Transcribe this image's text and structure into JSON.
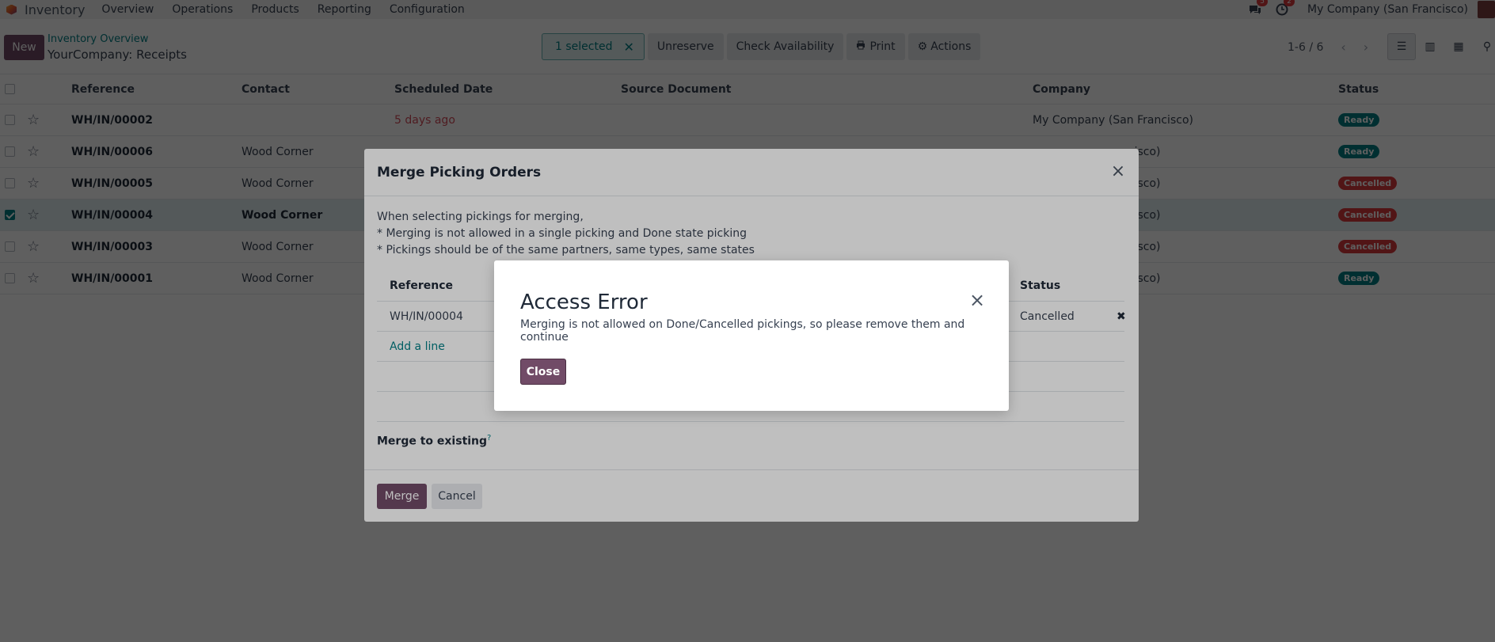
{
  "navbar": {
    "app_name": "Inventory",
    "menu": [
      "Overview",
      "Operations",
      "Products",
      "Reporting",
      "Configuration"
    ],
    "messages_count": "5",
    "activities_count": "2",
    "company": "My Company (San Francisco)"
  },
  "control_panel": {
    "new_label": "New",
    "breadcrumb_parent": "Inventory Overview",
    "breadcrumb_current": "YourCompany: Receipts",
    "selected_label": "1 selected",
    "unreserve_label": "Unreserve",
    "check_availability_label": "Check Availability",
    "print_label": "Print",
    "actions_label": "Actions",
    "pager": "1-6 / 6"
  },
  "list": {
    "headers": {
      "reference": "Reference",
      "contact": "Contact",
      "scheduled_date": "Scheduled Date",
      "source_document": "Source Document",
      "company": "Company",
      "status": "Status"
    },
    "rows": [
      {
        "reference": "WH/IN/00002",
        "contact": "",
        "date": "5 days ago",
        "company": "My Company (San Francisco)",
        "status": "Ready",
        "checked": false
      },
      {
        "reference": "WH/IN/00006",
        "contact": "Wood Corner",
        "date": "",
        "company": "ncisco)",
        "status": "Ready",
        "checked": false
      },
      {
        "reference": "WH/IN/00005",
        "contact": "Wood Corner",
        "date": "",
        "company": "ncisco)",
        "status": "Cancelled",
        "checked": false
      },
      {
        "reference": "WH/IN/00004",
        "contact": "Wood Corner",
        "date": "",
        "company": "ncisco)",
        "status": "Cancelled",
        "checked": true
      },
      {
        "reference": "WH/IN/00003",
        "contact": "Wood Corner",
        "date": "",
        "company": "ncisco)",
        "status": "Cancelled",
        "checked": false
      },
      {
        "reference": "WH/IN/00001",
        "contact": "Wood Corner",
        "date": "",
        "company": "ncisco)",
        "status": "Ready",
        "checked": false
      }
    ]
  },
  "merge_dialog": {
    "title": "Merge Picking Orders",
    "line1": "When selecting pickings for merging,",
    "line2": "* Merging is not allowed in a single picking and Done state picking",
    "line3": "* Pickings should be of the same partners, same types, same states",
    "col_reference": "Reference",
    "col_status": "Status",
    "row_reference": "WH/IN/00004",
    "row_status": "Cancelled",
    "add_line": "Add a line",
    "merge_existing": "Merge to existing",
    "merge_help": "?",
    "merge_label": "Merge",
    "cancel_label": "Cancel"
  },
  "error_dialog": {
    "title": "Access Error",
    "message": "Merging is not allowed on Done/Cancelled pickings, so please remove them and continue",
    "close_label": "Close"
  }
}
